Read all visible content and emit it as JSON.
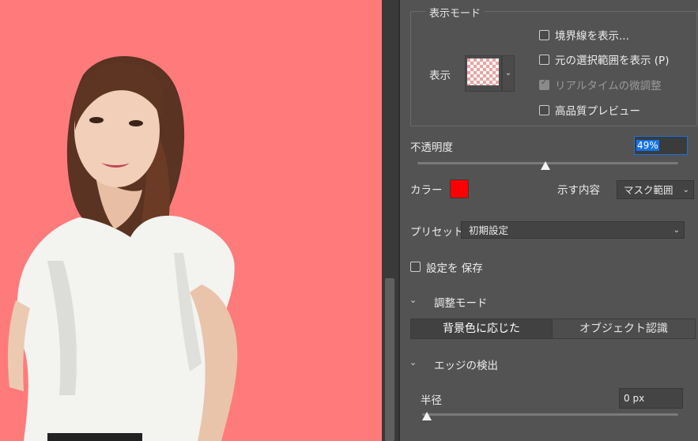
{
  "canvas": {
    "background_color": "#ff7b7b",
    "subject": "person-photo"
  },
  "view_mode": {
    "group_title": "表示モード",
    "view_label": "表示",
    "checkboxes": [
      {
        "label": "境界線を表示...",
        "checked": false,
        "enabled": true
      },
      {
        "label": "元の選択範囲を表示 (P)",
        "checked": false,
        "enabled": true
      },
      {
        "label": "リアルタイムの微調整",
        "checked": true,
        "enabled": false
      },
      {
        "label": "高品質プレビュー",
        "checked": false,
        "enabled": true
      }
    ]
  },
  "opacity": {
    "label": "不透明度",
    "value": "49%",
    "level": 0.49
  },
  "color": {
    "label": "カラー",
    "swatch": "#ff0000"
  },
  "show_content": {
    "label": "示す内容",
    "value": "マスク範囲"
  },
  "preset": {
    "label": "プリセット",
    "value": "初期設定"
  },
  "save_settings": {
    "label": "設定を 保存",
    "checked": false
  },
  "adjust_mode": {
    "title": "調整モード",
    "options": [
      "背景色に応じた",
      "オブジェクト認識"
    ],
    "active_index": 0
  },
  "edge_detection": {
    "title": "エッジの検出",
    "radius_label": "半径",
    "radius_value": "0 px",
    "radius_level": 0
  },
  "colors": {
    "accent": "#1473e6",
    "panel_bg": "#535353"
  }
}
